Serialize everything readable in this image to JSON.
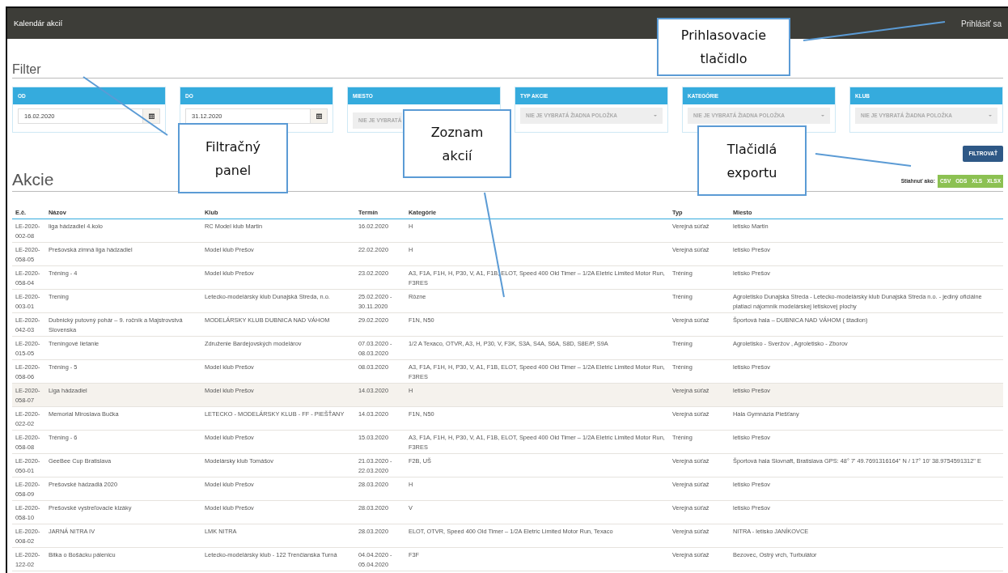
{
  "navbar": {
    "title": "Kalendár akcií",
    "login": "Prihlásiť sa"
  },
  "filter": {
    "heading": "Filter",
    "panels": [
      {
        "label": "OD",
        "kind": "date",
        "value": "16.02.2020"
      },
      {
        "label": "DO",
        "kind": "date",
        "value": "31.12.2020"
      },
      {
        "label": "MIESTO",
        "kind": "select",
        "placeholder": "NIE JE VYBRATÁ",
        "caret": false
      },
      {
        "label": "TYP AKCIE",
        "kind": "select",
        "placeholder": "NIE JE VYBRATÁ ŽIADNA POLOŽKA",
        "caret": true
      },
      {
        "label": "KATEGÓRIE",
        "kind": "select",
        "placeholder": "NIE JE VYBRATÁ ŽIADNA POLOŽKA",
        "caret": true
      },
      {
        "label": "KLUB",
        "kind": "select",
        "placeholder": "NIE JE VYBRATÁ ŽIADNA POLOŽKA",
        "caret": true
      }
    ],
    "button": "FILTROVAŤ"
  },
  "events": {
    "heading": "Akcie",
    "export": {
      "label": "Stiahnuť ako:",
      "formats": [
        "CSV",
        "ODS",
        "XLS",
        "XLSX"
      ]
    },
    "table": {
      "columns": [
        "E.č.",
        "Názov",
        "Klub",
        "Termín",
        "Kategórie",
        "Typ",
        "Miesto"
      ],
      "rows": [
        {
          "selected": false,
          "cells": [
            "LE-2020-002-08",
            "liga hádzadiel 4.kolo",
            "RC Model klub Martin",
            "16.02.2020",
            "H",
            "Verejná súťaž",
            "letisko Martin"
          ]
        },
        {
          "selected": false,
          "cells": [
            "LE-2020-058-05",
            "Prešovská zimná liga hádzadiel",
            "Model klub Prešov",
            "22.02.2020",
            "H",
            "Verejná súťaž",
            "letisko Prešov"
          ]
        },
        {
          "selected": false,
          "cells": [
            "LE-2020-058-04",
            "Tréning - 4",
            "Model klub Prešov",
            "23.02.2020",
            "A3, F1A, F1H, H, P30, V, A1, F1B, ELOT, Speed 400 Old Timer – 1/2A Eletric Limited Motor Run, F3RES",
            "Tréning",
            "letisko Prešov"
          ]
        },
        {
          "selected": false,
          "cells": [
            "LE-2020-003-01",
            "Trening",
            "Letecko-modelársky klub Dunajská Streda, n.o.",
            "25.02.2020 - 30.11.2020",
            "Rôzne",
            "Tréning",
            "Agroletisko Dunajska Streda - Letecko-modelársky klub Dunajská Streda n.o. - jediný oficiálne platiaci nájomník modelárskej letiskovej plochy"
          ]
        },
        {
          "selected": false,
          "cells": [
            "LE-2020-042-03",
            "Dubnický putovný pohár – 9. ročník a Majstrovstvá Slovenska",
            "MODELÁRSKY KLUB DUBNICA NAD VÁHOM",
            "29.02.2020",
            "F1N, N50",
            "Verejná súťaž",
            "Športová hala – DUBNICA NAD VÁHOM ( štadion)"
          ]
        },
        {
          "selected": false,
          "cells": [
            "LE-2020-015-05",
            "Treningové lietanie",
            "Združenie Bardejovských modelárov",
            "07.03.2020 - 08.03.2020",
            "1/2 A Texaco, OTVR, A3, H, P30, V, F3K, S3A, S4A, S6A, S8D, S8E/P, S9A",
            "Tréning",
            "Agroletisko - Sveržov , Agroletisko - Zborov"
          ]
        },
        {
          "selected": false,
          "cells": [
            "LE-2020-058-06",
            "Tréning - 5",
            "Model klub Prešov",
            "08.03.2020",
            "A3, F1A, F1H, H, P30, V, A1, F1B, ELOT, Speed 400 Old Timer – 1/2A Eletric Limited Motor Run, F3RES",
            "Tréning",
            "letisko Prešov"
          ]
        },
        {
          "selected": true,
          "cells": [
            "LE-2020-058-07",
            "Liga hádzadiel",
            "Model klub Prešov",
            "14.03.2020",
            "H",
            "Verejná súťaž",
            "letisko Prešov"
          ]
        },
        {
          "selected": false,
          "cells": [
            "LE-2020-022-02",
            "Memorial Miroslava Bučka",
            "LETECKO - MODELÁRSKY KLUB - FF - PIEŠŤANY",
            "14.03.2020",
            "F1N, N50",
            "Verejná súťaž",
            "Hala Gymnázia Piešťany"
          ]
        },
        {
          "selected": false,
          "cells": [
            "LE-2020-058-08",
            "Tréning - 6",
            "Model klub Prešov",
            "15.03.2020",
            "A3, F1A, F1H, H, P30, V, A1, F1B, ELOT, Speed 400 Old Timer – 1/2A Eletric Limited Motor Run, F3RES",
            "Tréning",
            "letisko Prešov"
          ]
        },
        {
          "selected": false,
          "cells": [
            "LE-2020-050-01",
            "GeeBee Cup Bratislava",
            "Modelársky klub Tomášov",
            "21.03.2020 - 22.03.2020",
            "F2B, UŠ",
            "Verejná súťaž",
            "Športová hala Slovnaft, Bratislava GPS: 48° 7' 49.7691316164\" N / 17° 10' 38.9754591312\" E"
          ]
        },
        {
          "selected": false,
          "cells": [
            "LE-2020-058-09",
            "Prešovské hádzadlá 2020",
            "Model klub Prešov",
            "28.03.2020",
            "H",
            "Verejná súťaž",
            "letisko Prešov"
          ]
        },
        {
          "selected": false,
          "cells": [
            "LE-2020-058-10",
            "Prešovské vystreľovacie klzáky",
            "Model klub Prešov",
            "28.03.2020",
            "V",
            "Verejná súťaž",
            "letisko Prešov"
          ]
        },
        {
          "selected": false,
          "cells": [
            "LE-2020-008-02",
            "JARNÁ NITRA IV",
            "LMK NITRA",
            "28.03.2020",
            "ELOT, OTVR, Speed 400 Old Timer – 1/2A Eletric Limited Motor Run, Texaco",
            "Verejná súťaž",
            "NITRA - letisko JANÍKOVCE"
          ]
        },
        {
          "selected": false,
          "cells": [
            "LE-2020-122-02",
            "Bitka o Bošácku pálenicu",
            "Letecko-modelársky klub - 122 Trenčianska Turná",
            "04.04.2020 - 05.04.2020",
            "F3F",
            "Verejná súťaž",
            "Bezovec, Ostrý vrch, Turbulátor"
          ]
        }
      ]
    }
  },
  "annotations": [
    {
      "text": "Prihlasovacie tlačidlo"
    },
    {
      "text": "Filtračný panel"
    },
    {
      "text": "Zoznam akcií"
    },
    {
      "text": "Tlačidlá exportu"
    }
  ]
}
